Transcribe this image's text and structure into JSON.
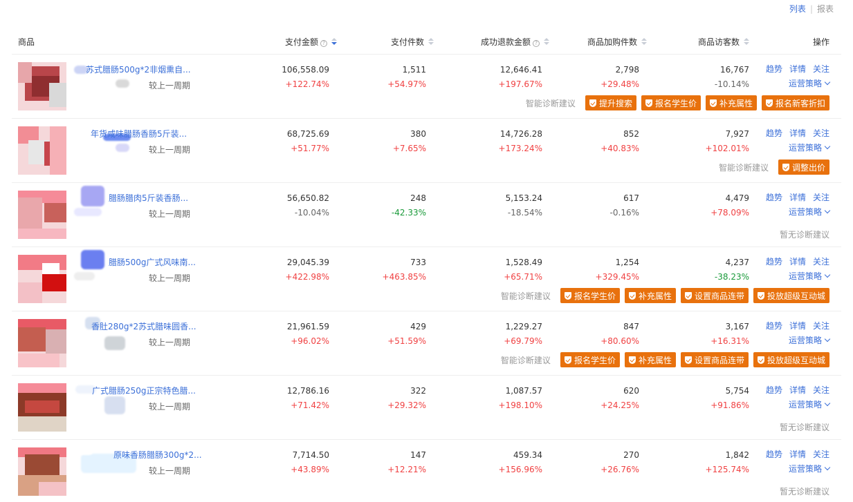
{
  "view": {
    "list_label": "列表",
    "separator": "|",
    "report_label": "报表"
  },
  "columns": {
    "product": "商品",
    "pay_amount": "支付金额",
    "pay_count": "支付件数",
    "refund_amount": "成功退款金额",
    "cart_count": "商品加购件数",
    "visitors": "商品访客数",
    "actions": "操作"
  },
  "labels": {
    "compare": "较上一周期",
    "diagnosis": "智能诊断建议",
    "no_diagnosis": "暂无诊断建议",
    "trend": "趋势",
    "detail": "详情",
    "follow": "关注",
    "strategy": "运营策略"
  },
  "rows": [
    {
      "name": "苏式腊肠500g*2非烟熏自...",
      "pay_amount": "106,558.09",
      "pay_amount_chg": "+122.74%",
      "pay_count": "1,511",
      "pay_count_chg": "+54.97%",
      "refund": "12,646.41",
      "refund_chg": "+197.67%",
      "cart": "2,798",
      "cart_chg": "+29.48%",
      "visitors": "16,767",
      "visitors_chg": "-10.14%",
      "tags": [
        "提升搜索",
        "报名学生价",
        "补充属性",
        "报名新客折扣"
      ]
    },
    {
      "name": "年货咸味腊肠香肠5斤装...",
      "pay_amount": "68,725.69",
      "pay_amount_chg": "+51.77%",
      "pay_count": "380",
      "pay_count_chg": "+7.65%",
      "refund": "14,726.28",
      "refund_chg": "+173.24%",
      "cart": "852",
      "cart_chg": "+40.83%",
      "visitors": "7,927",
      "visitors_chg": "+102.01%",
      "tags": [
        "调整出价"
      ]
    },
    {
      "name": "腊肠腊肉5斤装香肠...",
      "pay_amount": "56,650.82",
      "pay_amount_chg": "-10.04%",
      "pay_count": "248",
      "pay_count_chg": "-42.33%",
      "refund": "5,153.24",
      "refund_chg": "-18.54%",
      "cart": "617",
      "cart_chg": "-0.16%",
      "visitors": "4,479",
      "visitors_chg": "+78.09%",
      "tags": []
    },
    {
      "name": "腊肠500g广式风味南...",
      "pay_amount": "29,045.39",
      "pay_amount_chg": "+422.98%",
      "pay_count": "733",
      "pay_count_chg": "+463.85%",
      "refund": "1,528.49",
      "refund_chg": "+65.71%",
      "cart": "1,254",
      "cart_chg": "+329.45%",
      "visitors": "4,237",
      "visitors_chg": "-38.23%",
      "tags": [
        "报名学生价",
        "补充属性",
        "设置商品连带",
        "投放超级互动城"
      ]
    },
    {
      "name": "香肚280g*2苏式腊味圆香...",
      "pay_amount": "21,961.59",
      "pay_amount_chg": "+96.02%",
      "pay_count": "429",
      "pay_count_chg": "+51.59%",
      "refund": "1,229.27",
      "refund_chg": "+69.79%",
      "cart": "847",
      "cart_chg": "+80.60%",
      "visitors": "3,167",
      "visitors_chg": "+16.31%",
      "tags": [
        "报名学生价",
        "补充属性",
        "设置商品连带",
        "投放超级互动城"
      ]
    },
    {
      "name": "广式腊肠250g正宗特色腊...",
      "pay_amount": "12,786.16",
      "pay_amount_chg": "+71.42%",
      "pay_count": "322",
      "pay_count_chg": "+29.32%",
      "refund": "1,087.57",
      "refund_chg": "+198.10%",
      "cart": "620",
      "cart_chg": "+24.25%",
      "visitors": "5,754",
      "visitors_chg": "+91.86%",
      "tags": []
    },
    {
      "name": "原味香肠腊肠300g*2...",
      "pay_amount": "7,714.50",
      "pay_amount_chg": "+43.89%",
      "pay_count": "147",
      "pay_count_chg": "+12.21%",
      "refund": "459.34",
      "refund_chg": "+156.96%",
      "cart": "270",
      "cart_chg": "+26.76%",
      "visitors": "1,842",
      "visitors_chg": "+125.74%",
      "tags": []
    }
  ],
  "colors": {
    "link": "#3b6fd8",
    "up": "#f04142",
    "down_neutral": "#666666",
    "down_green": "#1a9a3a",
    "tag_bg": "#e8710d"
  }
}
